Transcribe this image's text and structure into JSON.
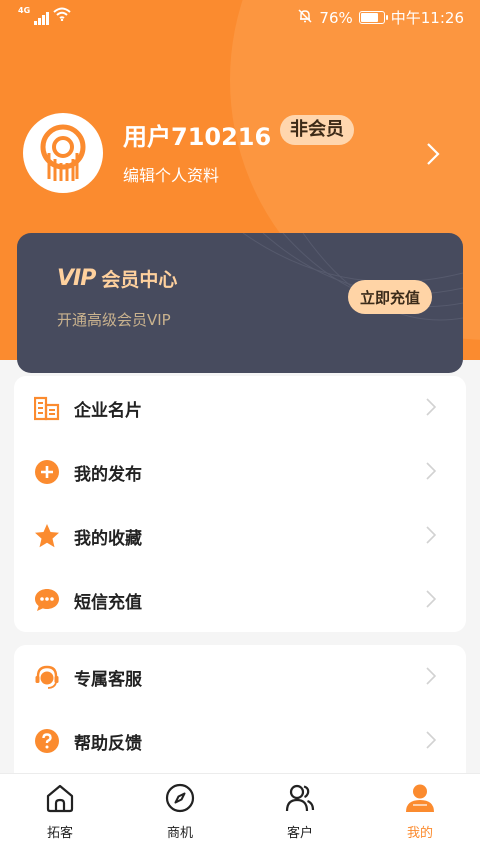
{
  "status_bar": {
    "network": "4G",
    "battery_percent": "76%",
    "time": "中午11:26"
  },
  "profile": {
    "username": "用户710216",
    "member_status": "非会员",
    "edit_link": "编辑个人资料"
  },
  "vip_card": {
    "logo_text": "VIP",
    "title": "会员中心",
    "subtitle": "开通高级会员VIP",
    "button_label": "立即充值"
  },
  "menu_group_1": [
    {
      "label": "企业名片",
      "icon": "building-icon"
    },
    {
      "label": "我的发布",
      "icon": "plus-circle-icon"
    },
    {
      "label": "我的收藏",
      "icon": "star-icon"
    },
    {
      "label": "短信充值",
      "icon": "chat-bubble-icon"
    }
  ],
  "menu_group_2": [
    {
      "label": "专属客服",
      "icon": "headset-icon"
    },
    {
      "label": "帮助反馈",
      "icon": "question-circle-icon"
    }
  ],
  "bottom_nav": {
    "items": [
      {
        "label": "拓客",
        "icon": "home-icon"
      },
      {
        "label": "商机",
        "icon": "compass-icon"
      },
      {
        "label": "客户",
        "icon": "users-icon"
      },
      {
        "label": "我的",
        "icon": "user-icon"
      }
    ],
    "active_index": 3
  },
  "colors": {
    "accent": "#fb8b2f",
    "vip_card_bg": "#474b5e",
    "vip_gold": "#ffd19e",
    "page_bg": "#f5f5f5"
  }
}
